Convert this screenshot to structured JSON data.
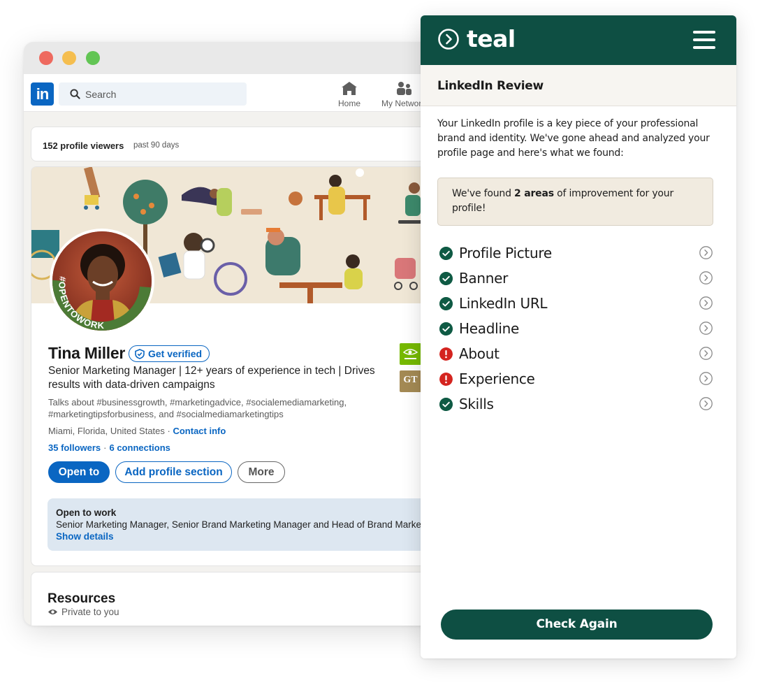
{
  "browser": {
    "window_buttons": [
      "close",
      "minimize",
      "maximize"
    ]
  },
  "linkedin": {
    "logo_text": "in",
    "search": {
      "placeholder": "Search"
    },
    "nav": [
      {
        "label": "Home",
        "icon": "home-icon"
      },
      {
        "label": "My Network",
        "icon": "network-icon"
      }
    ],
    "viewers": {
      "count": "152 profile viewers",
      "range": "past 90 days"
    },
    "profile": {
      "name": "Tina Miller",
      "verify_label": "Get verified",
      "avatar_frame_text": "#OPENTOWORK",
      "headline": "Senior Marketing Manager | 12+ years of experience in tech | Drives results with data-driven campaigns",
      "talks_about": "Talks about #businessgrowth, #marketingadvice, #socialemediamarketing, #marketingtipsforbusiness, and #socialmediamarketingtips",
      "location": "Miami, Florida, United States",
      "contact_label": "Contact info",
      "followers": "35 followers",
      "connections": "6 connections",
      "buttons": {
        "open_to": "Open to",
        "add_section": "Add profile section",
        "more": "More"
      },
      "open_to_work": {
        "title": "Open to work",
        "roles": "Senior Marketing Manager, Senior Brand Marketing Manager and Head of Brand Marketing",
        "link": "Show details"
      },
      "companies": [
        {
          "name": "NVIDIA",
          "logo_text": "NVIDIA"
        },
        {
          "name": "Georgia Tech",
          "logo_text": "GT"
        }
      ]
    },
    "resources": {
      "title": "Resources",
      "subtitle": "Private to you"
    }
  },
  "teal": {
    "brand": "teal",
    "section_title": "LinkedIn Review",
    "intro": "Your LinkedIn profile is a key piece of your professional brand and identity. We've gone ahead and analyzed your profile page and here's what we found:",
    "found_prefix": "We've found ",
    "found_bold": "2 areas",
    "found_suffix": " of improvement for your profile!",
    "checklist": [
      {
        "label": "Profile Picture",
        "status": "ok"
      },
      {
        "label": "Banner",
        "status": "ok"
      },
      {
        "label": "LinkedIn URL",
        "status": "ok"
      },
      {
        "label": "Headline",
        "status": "ok"
      },
      {
        "label": "About",
        "status": "warn"
      },
      {
        "label": "Experience",
        "status": "warn"
      },
      {
        "label": "Skills",
        "status": "ok"
      }
    ],
    "cta": "Check Again",
    "colors": {
      "brand": "#0e4f43",
      "ok": "#0f5a44",
      "warn": "#d4241f",
      "linkedin_blue": "#0a66c2"
    }
  }
}
